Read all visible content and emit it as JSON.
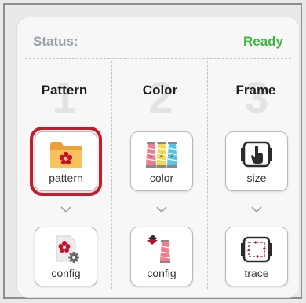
{
  "status": {
    "label": "Status:",
    "value": "Ready",
    "value_color": "#3fb53f"
  },
  "columns": [
    {
      "number": "1",
      "title": "Pattern",
      "top": {
        "label": "pattern",
        "icon": "folder-flower-icon",
        "selected": true
      },
      "bottom": {
        "label": "config",
        "icon": "flower-file-gear-icon"
      }
    },
    {
      "number": "2",
      "title": "Color",
      "top": {
        "label": "color",
        "icon": "thread-spools-icon"
      },
      "bottom": {
        "label": "config",
        "icon": "paint-spool-icon"
      }
    },
    {
      "number": "3",
      "title": "Frame",
      "top": {
        "label": "size",
        "icon": "hoop-hand-icon"
      },
      "bottom": {
        "label": "trace",
        "icon": "hoop-trace-icon"
      }
    }
  ],
  "colors": {
    "selected_outline": "#c61c2a",
    "accent_green": "#3fb53f"
  }
}
